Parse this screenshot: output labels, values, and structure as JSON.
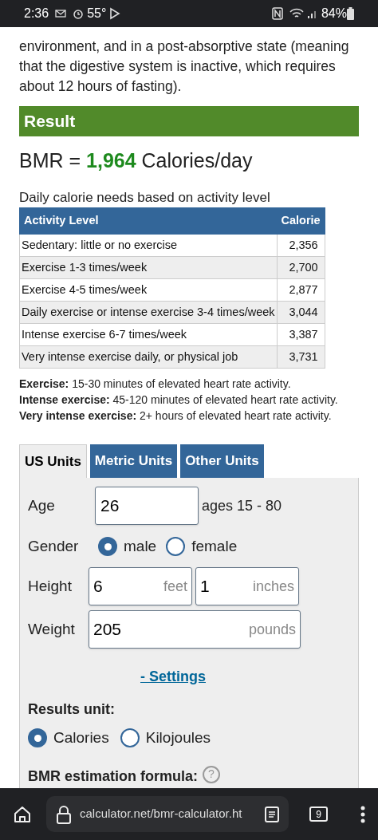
{
  "status_bar": {
    "time": "2:36",
    "temperature": "55°",
    "battery": "84%"
  },
  "intro_text": "environment, and in a post-absorptive state (meaning that the digestive system is inactive, which requires about 12 hours of fasting).",
  "result": {
    "title": "Result",
    "bmr_prefix": "BMR = ",
    "bmr_value": "1,964",
    "bmr_suffix": " Calories/day"
  },
  "table": {
    "caption": "Daily calorie needs based on activity level",
    "columns": [
      "Activity Level",
      "Calorie"
    ],
    "rows": [
      [
        "Sedentary: little or no exercise",
        "2,356"
      ],
      [
        "Exercise 1-3 times/week",
        "2,700"
      ],
      [
        "Exercise 4-5 times/week",
        "2,877"
      ],
      [
        "Daily exercise or intense exercise 3-4 times/week",
        "3,044"
      ],
      [
        "Intense exercise 6-7 times/week",
        "3,387"
      ],
      [
        "Very intense exercise daily, or physical job",
        "3,731"
      ]
    ]
  },
  "notes": [
    "**Exercise:** 15-30 minutes of elevated heart rate activity.",
    "**Intense exercise:** 45-120 minutes of elevated heart rate activity.",
    "**Very intense exercise:** 2+ hours of elevated heart rate activity."
  ],
  "tabs": [
    {
      "label": "US Units",
      "selected": true
    },
    {
      "label": "Metric Units",
      "selected": false
    },
    {
      "label": "Other Units",
      "selected": false
    }
  ],
  "form": {
    "age": {
      "label": "Age",
      "value": "26",
      "hint": "ages 15 - 80"
    },
    "gender": {
      "label": "Gender",
      "options": [
        {
          "label": "male",
          "selected": true
        },
        {
          "label": "female",
          "selected": false
        }
      ]
    },
    "height": {
      "label": "Height",
      "fields": [
        {
          "value": "6",
          "unit": "feet"
        },
        {
          "value": "1",
          "unit": "inches"
        }
      ]
    },
    "weight": {
      "label": "Weight",
      "value": "205",
      "unit": "pounds"
    },
    "settings_link": "- Settings",
    "results_unit": {
      "label": "Results unit:",
      "options": [
        {
          "label": "Calories",
          "selected": true
        },
        {
          "label": "Kilojoules",
          "selected": false
        }
      ]
    },
    "formula_label": "BMR estimation formula:",
    "help": "?"
  },
  "browser_bar": {
    "url": "calculator.net/bmr-calculator.ht",
    "tab_count": "9"
  }
}
